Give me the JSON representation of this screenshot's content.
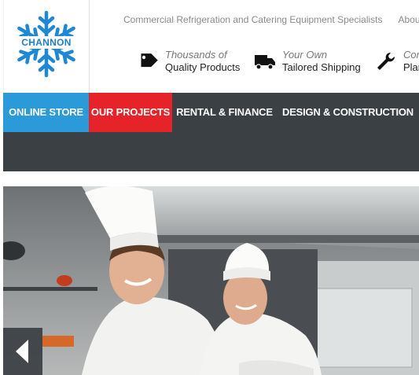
{
  "logo": {
    "text": "CHANNON",
    "flake_color": "#1e88d4"
  },
  "top_links": {
    "tagline": "Commercial Refrigeration and Catering Equipment Specialists",
    "about": "About Us"
  },
  "features": [
    {
      "icon": "price-tag-icon",
      "line1": "Thousands of",
      "line2": "Quality Products"
    },
    {
      "icon": "delivery-truck-icon",
      "line1": "Your Own",
      "line2": "Tailored Shipping"
    },
    {
      "icon": "wrench-icon",
      "line1": "Cor",
      "line2": "Plan"
    }
  ],
  "nav": {
    "items": [
      {
        "label": "ONLINE STORE",
        "color": "#2a9ad8"
      },
      {
        "label": "OUR PROJECTS",
        "color": "#e52328"
      },
      {
        "label": "RENTAL & FINANCE"
      },
      {
        "label": "DESIGN & CONSTRUCTION"
      }
    ],
    "bar_color": "#3b4044"
  },
  "hero": {
    "description": "two-chefs-kitchen-photo"
  },
  "slider": {
    "prev_icon": "chevron-left-icon"
  }
}
